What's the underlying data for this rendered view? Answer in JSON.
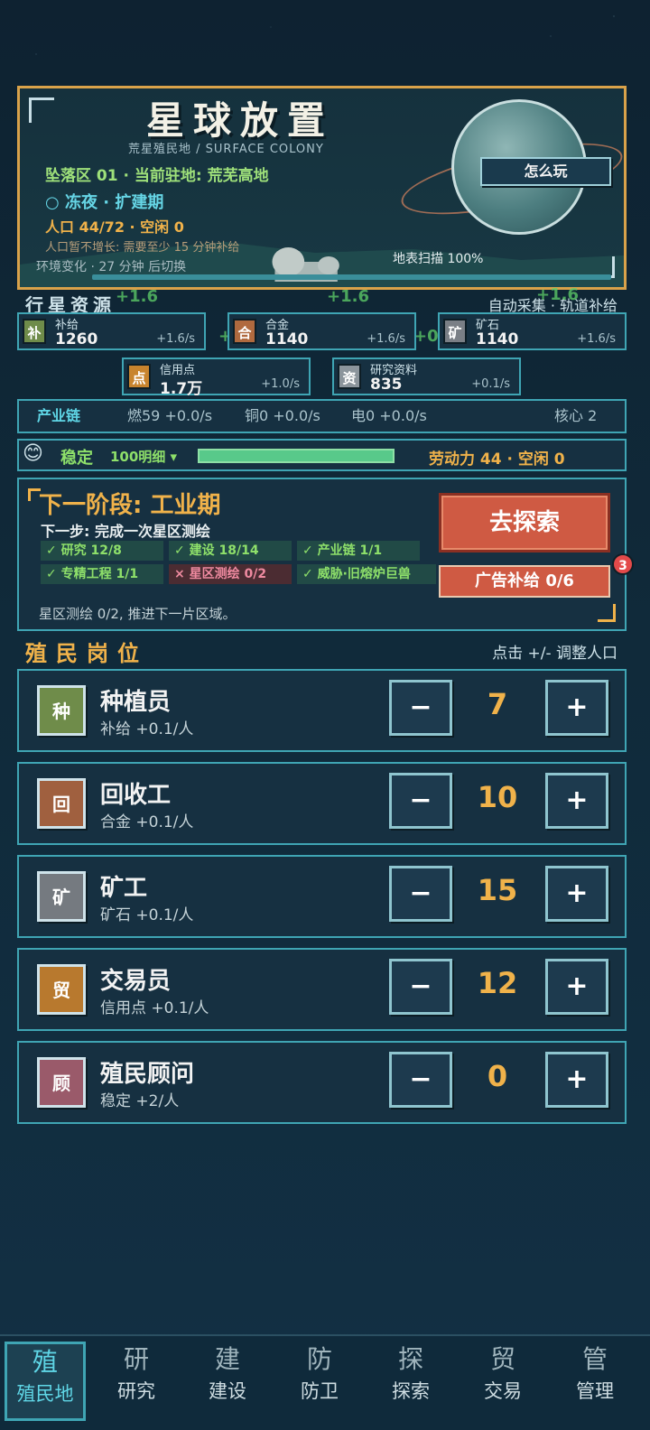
{
  "header": {
    "title": "星球放置",
    "subtitle": "荒星殖民地 / SURFACE COLONY",
    "location": "坠落区 01 · 当前驻地: 荒芜高地",
    "season": "○ 冻夜 · 扩建期",
    "population": "人口 44/72 · 空闲 0",
    "pop_note": "人口暂不增长: 需要至少 15 分钟补给",
    "env_change": "环境变化 · 27 分钟 后切换",
    "scan": "地表扫描 100%",
    "scan_progress": 1.0,
    "how_to_play": "怎么玩"
  },
  "resources": {
    "heading": "行星资源",
    "auto": "自动采集 · 轨道补给",
    "floaters": [
      "+1.6",
      "+1.6",
      "+1.6",
      "+0",
      "+0"
    ],
    "items": [
      {
        "icon": "补",
        "name": "补给",
        "value": "1260",
        "rate": "+1.6/s",
        "color": "#6f8c4a"
      },
      {
        "icon": "合",
        "name": "合金",
        "value": "1140",
        "rate": "+1.6/s",
        "color": "#b06a3f"
      },
      {
        "icon": "矿",
        "name": "矿石",
        "value": "1140",
        "rate": "+1.6/s",
        "color": "#7a7f86"
      },
      {
        "icon": "点",
        "name": "信用点",
        "value": "1.7万",
        "rate": "+1.0/s",
        "color": "#c8842e"
      },
      {
        "icon": "资",
        "name": "研究资料",
        "value": "835",
        "rate": "+0.1/s",
        "color": "#8c959c"
      }
    ]
  },
  "chain": {
    "label": "产业链",
    "fuel": "燃59 +0.0/s",
    "copper": "铜0 +0.0/s",
    "power": "电0 +0.0/s",
    "core": "核心 2"
  },
  "stability": {
    "emoji": "😊",
    "label": "稳定",
    "value": "100明细 ▾",
    "fill": 1.0,
    "labor": "劳动力 44 · 空闲 0"
  },
  "phase": {
    "title": "下一阶段: 工业期",
    "next_step": "下一步: 完成一次星区测绘",
    "checks": [
      {
        "text": "✓ 研究 12/8",
        "ok": true
      },
      {
        "text": "✓ 建设 18/14",
        "ok": true
      },
      {
        "text": "✓ 产业链 1/1",
        "ok": true
      },
      {
        "text": "✓ 专精工程 1/1",
        "ok": true
      },
      {
        "text": "× 星区测绘 0/2",
        "ok": false
      },
      {
        "text": "✓ 威胁·旧熔炉巨兽",
        "ok": true
      }
    ],
    "footer": "星区测绘 0/2, 推进下一片区域。",
    "explore_label": "去探索",
    "ad_label": "广告补给 0/6",
    "ad_badge": "3"
  },
  "jobs": {
    "heading": "殖民岗位",
    "hint": "点击 +/- 调整人口",
    "minus": "−",
    "plus": "+",
    "items": [
      {
        "icon": "种",
        "name": "种植员",
        "rate": "补给 +0.1/人",
        "count": "7",
        "color": "#6f8c4a"
      },
      {
        "icon": "回",
        "name": "回收工",
        "rate": "合金 +0.1/人",
        "count": "10",
        "color": "#a0603f"
      },
      {
        "icon": "矿",
        "name": "矿工",
        "rate": "矿石 +0.1/人",
        "count": "15",
        "color": "#757a80"
      },
      {
        "icon": "贸",
        "name": "交易员",
        "rate": "信用点 +0.1/人",
        "count": "12",
        "color": "#b8792e"
      },
      {
        "icon": "顾",
        "name": "殖民顾问",
        "rate": "稳定 +2/人",
        "count": "0",
        "color": "#9a5a6a"
      }
    ]
  },
  "nav": {
    "items": [
      {
        "char": "殖",
        "label": "殖民地",
        "active": true
      },
      {
        "char": "研",
        "label": "研究",
        "active": false
      },
      {
        "char": "建",
        "label": "建设",
        "active": false
      },
      {
        "char": "防",
        "label": "防卫",
        "active": false
      },
      {
        "char": "探",
        "label": "探索",
        "active": false
      },
      {
        "char": "贸",
        "label": "交易",
        "active": false
      },
      {
        "char": "管",
        "label": "管理",
        "active": false
      }
    ]
  }
}
